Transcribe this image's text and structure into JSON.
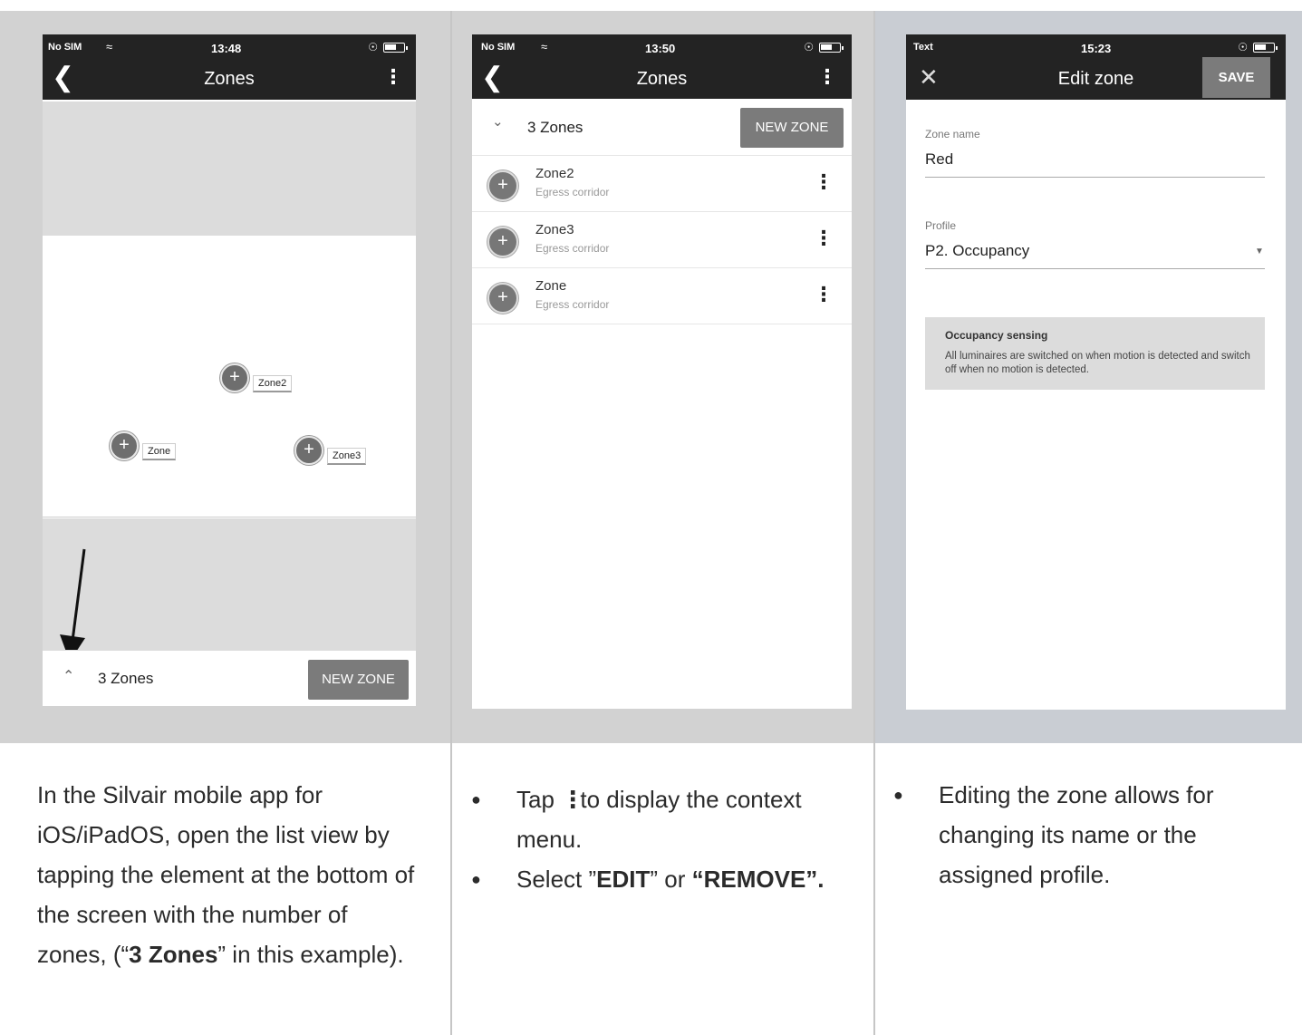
{
  "panel1": {
    "status": {
      "carrier": "No SIM",
      "time": "13:48"
    },
    "title": "Zones",
    "map_zones": [
      {
        "label": "Zone2"
      },
      {
        "label": "Zone"
      },
      {
        "label": "Zone3"
      }
    ],
    "bottom": {
      "count_label": "3 Zones",
      "new_zone_label": "NEW ZONE"
    },
    "caption": {
      "t1": "In the Silvair mobile app for iOS/iPadOS, open the list view by tapping the element at the bottom of the screen with the number of zones, (“",
      "bold": "3 Zones",
      "t2": "” in this example)."
    }
  },
  "panel2": {
    "status": {
      "carrier": "No SIM",
      "time": "13:50"
    },
    "title": "Zones",
    "header": {
      "count_label": "3 Zones",
      "new_zone_label": "NEW ZONE"
    },
    "zones": [
      {
        "name": "Zone2",
        "profile": "Egress corridor"
      },
      {
        "name": "Zone3",
        "profile": "Egress corridor"
      },
      {
        "name": "Zone",
        "profile": "Egress corridor"
      }
    ],
    "caption": {
      "b1_pre": "Tap",
      "b1_post": "to display the context menu.",
      "b2_pre": "Select ”",
      "b2_edit": "EDIT",
      "b2_mid": "” or ",
      "b2_remove": "“REMOVE”."
    }
  },
  "panel3": {
    "status": {
      "carrier": "Text",
      "time": "15:23"
    },
    "title": "Edit zone",
    "save_label": "SAVE",
    "zone_name_label": "Zone name",
    "zone_name_value": "Red",
    "profile_label": "Profile",
    "profile_value": "P2. Occupancy",
    "info_title": "Occupancy sensing",
    "info_text": "All luminaires are switched on when motion is detected and switch off when no motion is detected.",
    "caption": "Editing the zone allows for changing its name or the assigned profile."
  }
}
